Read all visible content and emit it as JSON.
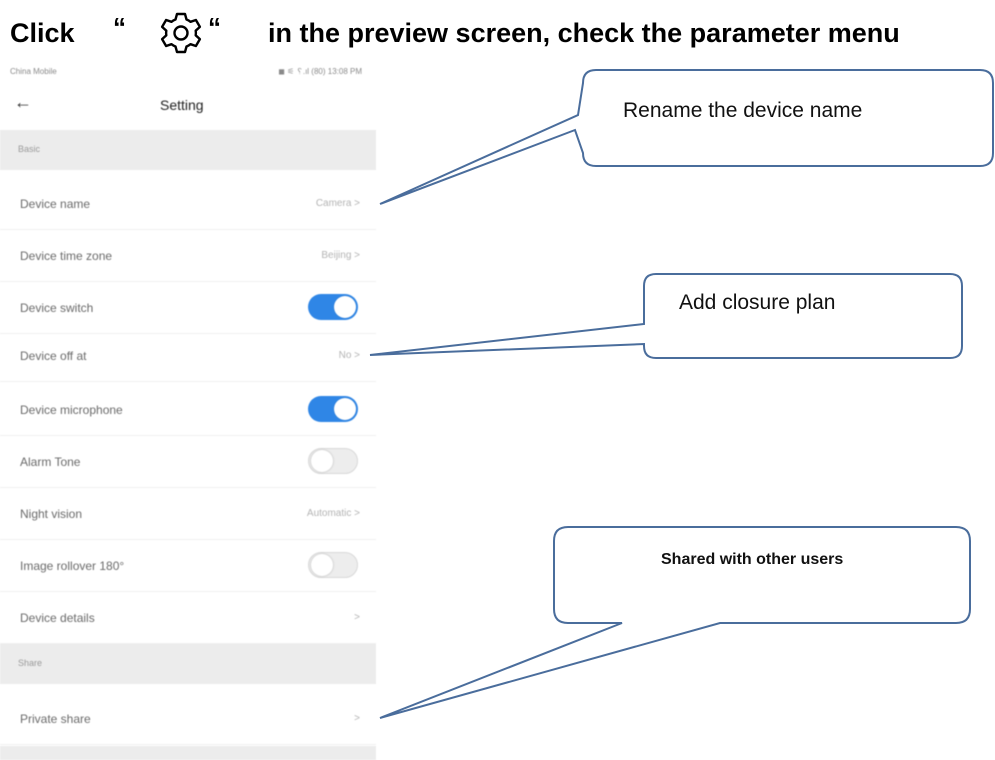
{
  "heading": {
    "click": "Click",
    "quote_open": "“",
    "quote_close": "“",
    "rest": "in the preview screen, check the parameter menu"
  },
  "statusbar": {
    "carrier": "China Mobile",
    "icons": "◼ ⚟ ␦.ıl (80) 13:08 PM"
  },
  "navbar": {
    "back": "←",
    "title": "Setting"
  },
  "sections": {
    "basic": "Basic",
    "share": "Share"
  },
  "rows": {
    "device_name": {
      "label": "Device name",
      "value": "Camera >"
    },
    "time_zone": {
      "label": "Device time zone",
      "value": "Beijing >"
    },
    "device_switch": {
      "label": "Device switch"
    },
    "device_off": {
      "label": "Device off at",
      "value": "No >"
    },
    "microphone": {
      "label": "Device microphone"
    },
    "alarm_tone": {
      "label": "Alarm Tone"
    },
    "night_vision": {
      "label": "Night vision",
      "value": "Automatic >"
    },
    "image_rollover": {
      "label": "Image rollover 180°"
    },
    "device_details": {
      "label": "Device details",
      "value": ">"
    },
    "private_share": {
      "label": "Private share",
      "value": ">"
    }
  },
  "toggles": {
    "device_switch": true,
    "microphone": true,
    "alarm_tone": false,
    "image_rollover": false
  },
  "callouts": {
    "rename": "Rename the device name",
    "closure": "Add closure plan",
    "shared": "Shared with other users"
  },
  "colors": {
    "toggle_on": "#2f86e6",
    "callout_border": "#4a6d9c"
  }
}
